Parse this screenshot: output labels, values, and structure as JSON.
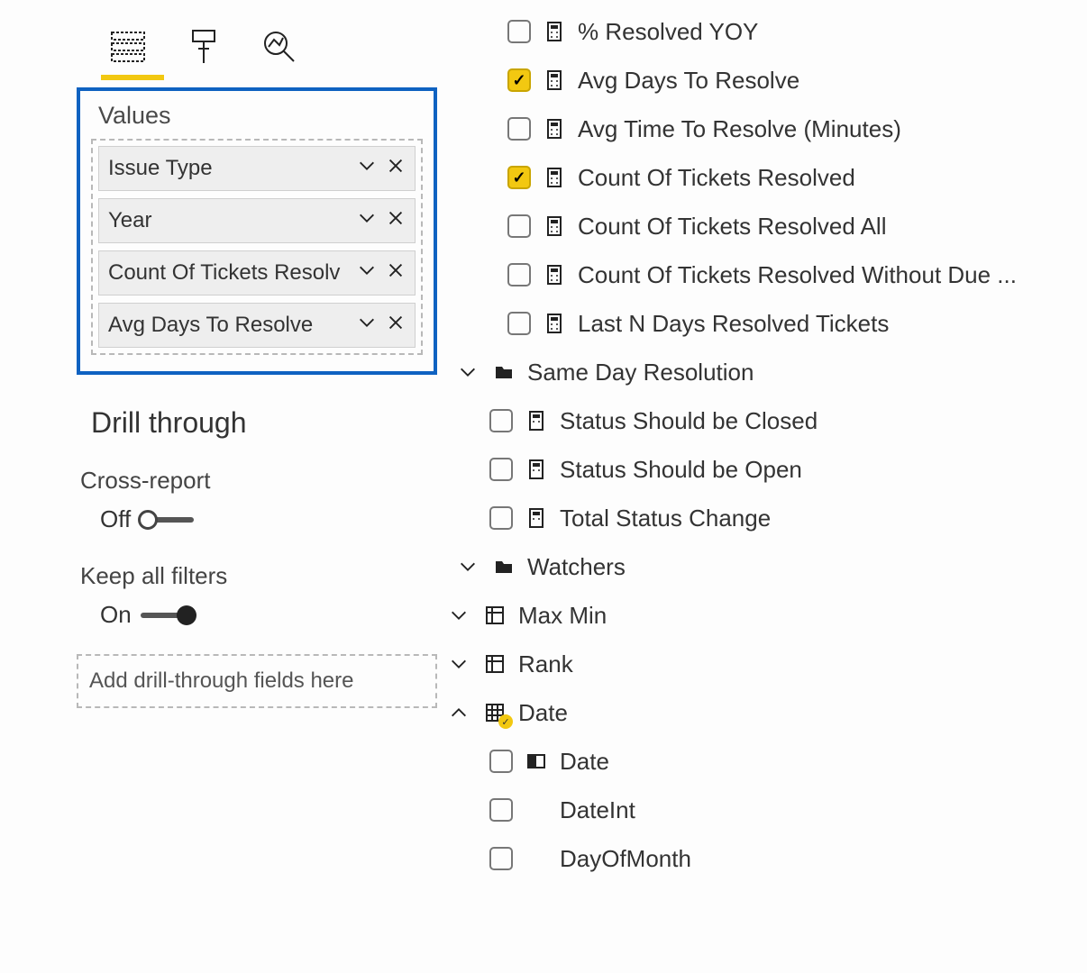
{
  "colors": {
    "accent_yellow": "#f2c811",
    "highlight_blue": "#0f62c1"
  },
  "values_well": {
    "title": "Values",
    "items": [
      {
        "label": "Issue Type"
      },
      {
        "label": "Year"
      },
      {
        "label": "Count Of Tickets Resolv"
      },
      {
        "label": "Avg Days To Resolve"
      }
    ]
  },
  "drill": {
    "title": "Drill through",
    "cross_report": {
      "label": "Cross-report",
      "state": "Off"
    },
    "keep_filters": {
      "label": "Keep all filters",
      "state": "On"
    },
    "drop_placeholder": "Add drill-through fields here"
  },
  "fields": {
    "measures": [
      {
        "label": "% Resolved YOY",
        "checked": false
      },
      {
        "label": "Avg Days To Resolve",
        "checked": true
      },
      {
        "label": "Avg Time To Resolve (Minutes)",
        "checked": false
      },
      {
        "label": "Count Of Tickets Resolved",
        "checked": true
      },
      {
        "label": "Count Of Tickets Resolved All",
        "checked": false
      },
      {
        "label": "Count Of Tickets Resolved Without Due ...",
        "checked": false
      },
      {
        "label": "Last N Days Resolved Tickets",
        "checked": false
      }
    ],
    "same_day_resolution": {
      "label": "Same Day Resolution",
      "children": [
        {
          "label": "Status Should be Closed",
          "checked": false
        },
        {
          "label": "Status Should be Open",
          "checked": false
        },
        {
          "label": "Total Status Change",
          "checked": false
        }
      ]
    },
    "watchers": {
      "label": "Watchers"
    },
    "max_min": {
      "label": "Max Min"
    },
    "rank": {
      "label": "Rank"
    },
    "date": {
      "label": "Date",
      "children": [
        {
          "label": "Date",
          "checked": false,
          "icon": "hierarchy"
        },
        {
          "label": "DateInt",
          "checked": false,
          "icon": ""
        },
        {
          "label": "DayOfMonth",
          "checked": false,
          "icon": ""
        }
      ]
    }
  }
}
